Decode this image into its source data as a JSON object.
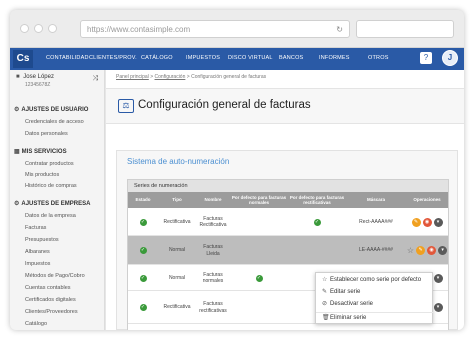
{
  "browser": {
    "url": "https://www.contasimple.com",
    "reload_icon": "reload-icon"
  },
  "nav": {
    "logo": "Cs",
    "items": [
      "CONTABILIDAD",
      "CLIENTES/PROV.",
      "CATÁLOGO",
      "IMPUESTOS",
      "DISCO VIRTUAL",
      "BANCOS",
      "INFORMES",
      "OTROS"
    ],
    "help": "?",
    "avatar": "J"
  },
  "sidebar": {
    "user_name": "Jose López",
    "user_id": "12345678Z",
    "sections": [
      {
        "title": "AJUSTES DE USUARIO",
        "items": [
          "Credenciales de acceso",
          "Datos personales"
        ]
      },
      {
        "title": "MIS SERVICIOS",
        "items": [
          "Contratar productos",
          "Mis productos",
          "Histórico de compras"
        ]
      },
      {
        "title": "AJUSTES DE EMPRESA",
        "items": [
          "Datos de la empresa",
          "Facturas",
          "Presupuestos",
          "Albaranes",
          "Impuestos",
          "Métodos de Pago/Cobro",
          "Cuentas contables",
          "Certificados digitales",
          "Clientes/Proveedores",
          "Catálogo"
        ]
      }
    ]
  },
  "main": {
    "breadcrumb": [
      "Panel principal",
      "Configuración",
      "Configuración general de facturas"
    ],
    "page_title": "Configuración general de facturas",
    "section_title": "Sistema de auto-numeración",
    "table_caption": "Series de numeración",
    "columns": [
      "Estado",
      "Tipo",
      "Nombre",
      "Por defecto para facturas normales",
      "Por defecto para facturas rectificativas",
      "Máscara",
      "Operaciones"
    ],
    "rows": [
      {
        "estado": true,
        "tipo": "Rectificativa",
        "nombre": "Facturas Rectificativa",
        "def_normal": false,
        "def_rect": true,
        "mascara": "Rect-AAAA###",
        "selected": false
      },
      {
        "estado": true,
        "tipo": "Normal",
        "nombre": "Facturas Lleida",
        "def_normal": false,
        "def_rect": false,
        "mascara": "LE-AAAA-####",
        "selected": true
      },
      {
        "estado": true,
        "tipo": "Normal",
        "nombre": "Facturas normales",
        "def_normal": true,
        "def_rect": false,
        "mascara": "",
        "selected": false
      },
      {
        "estado": true,
        "tipo": "Rectificativa",
        "nombre": "Facturas rectificativas",
        "def_normal": false,
        "def_rect": false,
        "mascara": "",
        "selected": false
      }
    ]
  },
  "context_menu": {
    "items": [
      {
        "label": "Establecer como serie por defecto",
        "icon": "star-icon"
      },
      {
        "label": "Editar serie",
        "icon": "pencil-icon"
      },
      {
        "label": "Desactivar serie",
        "icon": "disable-icon"
      },
      {
        "label": "Eliminar serie",
        "icon": "trash-icon"
      }
    ]
  },
  "colors": {
    "nav": "#2a5aa6",
    "accent_title": "#4b8fd1",
    "check_green": "#3a9a3a",
    "op_edit": "#f0a020",
    "op_toggle": "#e2573a",
    "op_more": "#5a5a5a"
  }
}
